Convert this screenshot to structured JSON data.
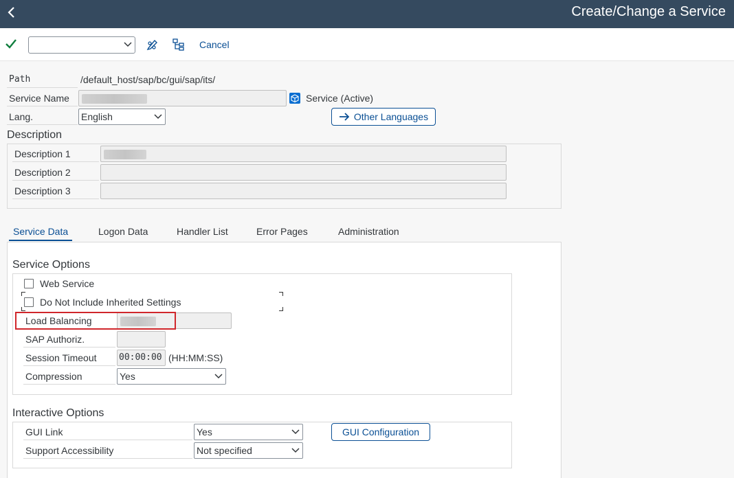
{
  "header": {
    "title": "Create/Change a Service"
  },
  "toolbar": {
    "cancel_label": "Cancel",
    "command_value": ""
  },
  "fields": {
    "path_label": "Path",
    "path_value": "/default_host/sap/bc/gui/sap/its/",
    "service_name_label": "Service Name",
    "service_status": "Service (Active)",
    "lang_label": "Lang.",
    "lang_value": "English",
    "other_languages_label": "Other Languages"
  },
  "description": {
    "title": "Description",
    "rows": [
      {
        "label": "Description 1"
      },
      {
        "label": "Description 2"
      },
      {
        "label": "Description 3"
      }
    ]
  },
  "tabs": [
    {
      "label": "Service Data",
      "active": true
    },
    {
      "label": "Logon Data"
    },
    {
      "label": "Handler List"
    },
    {
      "label": "Error Pages"
    },
    {
      "label": "Administration"
    }
  ],
  "service_options": {
    "title": "Service Options",
    "web_service_label": "Web Service",
    "no_inherit_label": "Do Not Include Inherited Settings",
    "load_balancing_label": "Load Balancing",
    "sap_authoriz_label": "SAP Authoriz.",
    "session_timeout_label": "Session Timeout",
    "session_timeout_value": "00:00:00",
    "session_timeout_unit": "(HH:MM:SS)",
    "compression_label": "Compression",
    "compression_value": "Yes"
  },
  "interactive_options": {
    "title": "Interactive Options",
    "gui_link_label": "GUI Link",
    "gui_link_value": "Yes",
    "gui_config_label": "GUI Configuration",
    "support_access_label": "Support Accessibility",
    "support_access_value": "Not specified"
  },
  "colors": {
    "header_bg": "#354a5f",
    "accent": "#0a4f94",
    "highlight": "#d0262b",
    "check": "#107e3e"
  }
}
